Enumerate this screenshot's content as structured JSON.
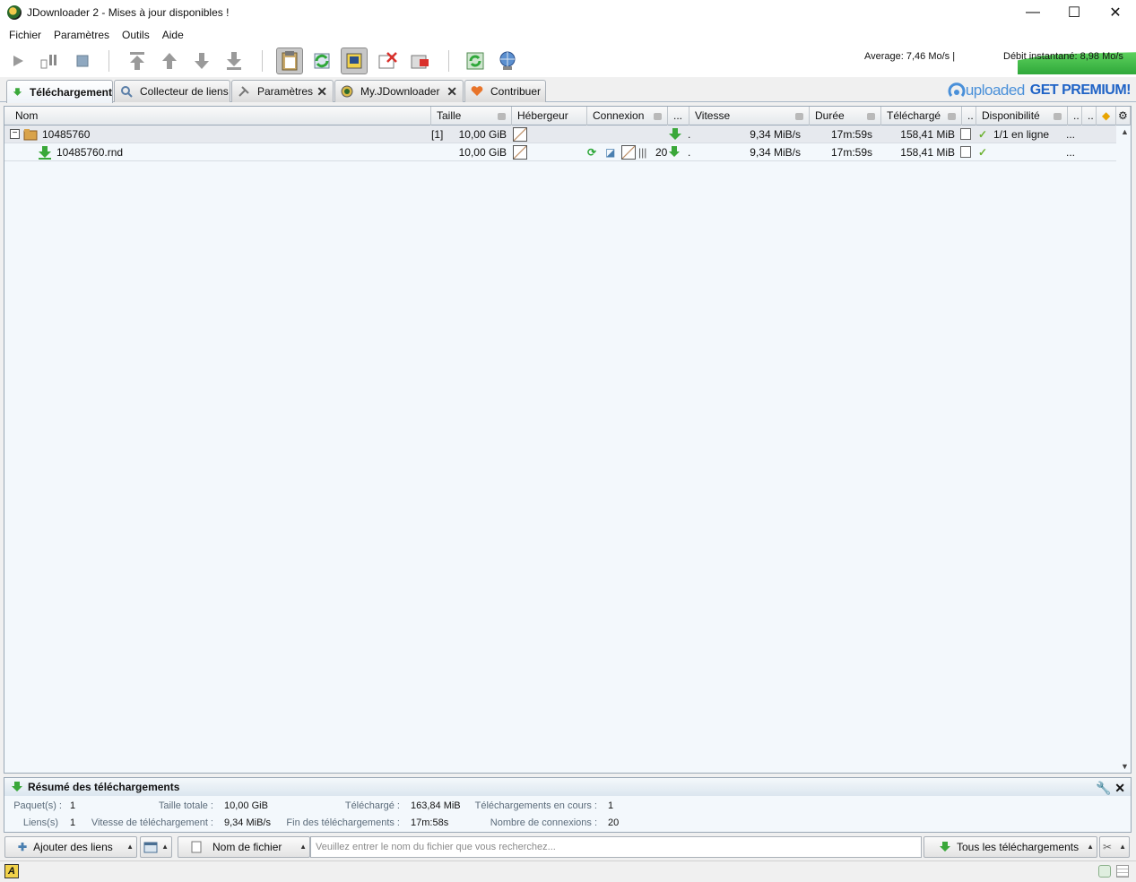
{
  "window": {
    "title": "JDownloader 2 - Mises à jour disponibles !",
    "controls": {
      "minimize": "—",
      "maximize": "☐",
      "close": "✕"
    }
  },
  "menu": [
    "Fichier",
    "Paramètres",
    "Outils",
    "Aide"
  ],
  "speeds": {
    "average": "Average: 7,46 Mo/s |",
    "instant": "Débit instantané: 8,98 Mo/s"
  },
  "tabs": [
    {
      "label": "Téléchargement",
      "closable": false,
      "active": true
    },
    {
      "label": "Collecteur de liens",
      "closable": false
    },
    {
      "label": "Paramètres",
      "closable": true
    },
    {
      "label": "My.JDownloader",
      "closable": true
    },
    {
      "label": "Contribuer",
      "closable": false
    }
  ],
  "banner": {
    "brand": "uploaded",
    "cta": "GET PREMIUM!"
  },
  "columns": {
    "name": "Nom",
    "size": "Taille",
    "host": "Hébergeur",
    "connection": "Connexion",
    "more1": "...",
    "speed": "Vitesse",
    "duration": "Durée",
    "downloaded": "Téléchargé",
    "more2": "..",
    "availability": "Disponibilité",
    "more3": "..",
    "more4": ".."
  },
  "rows": [
    {
      "type": "package",
      "expander": "−",
      "name": "10485760",
      "count": "[1]",
      "size": "10,00 GiB",
      "dot": ".",
      "speed": "9,34 MiB/s",
      "duration": "17m:59s",
      "downloaded": "158,41 MiB",
      "availability": "1/1 en ligne",
      "extra": "..."
    },
    {
      "type": "file",
      "name": "10485760.rnd",
      "size": "10,00 GiB",
      "connections": "20",
      "dot": ".",
      "speed": "9,34 MiB/s",
      "duration": "17m:59s",
      "downloaded": "158,41 MiB",
      "availability": "",
      "extra": "..."
    }
  ],
  "summary": {
    "title": "Résumé des téléchargements",
    "packages_label": "Paquet(s) :",
    "packages": "1",
    "links_label": "Liens(s)",
    "links": "1",
    "total_size_label": "Taille totale :",
    "total_size": "10,00 GiB",
    "speed_label": "Vitesse de téléchargement :",
    "speed": "9,34 MiB/s",
    "downloaded_label": "Téléchargé :",
    "downloaded": "163,84 MiB",
    "eta_label": "Fin des téléchargements :",
    "eta": "17m:58s",
    "running_label": "Téléchargements en cours :",
    "running": "1",
    "connections_label": "Nombre de connexions :",
    "connections": "20"
  },
  "bottom": {
    "add_links": "Ajouter des liens",
    "search_field": "Nom de fichier",
    "search_placeholder": "Veuillez entrer le nom du fichier que vous recherchez...",
    "filter": "Tous les téléchargements"
  },
  "colors": {
    "accent_green": "#3aa83a",
    "banner_blue": "#1f63c6",
    "table_bg": "#f3f8fc"
  }
}
